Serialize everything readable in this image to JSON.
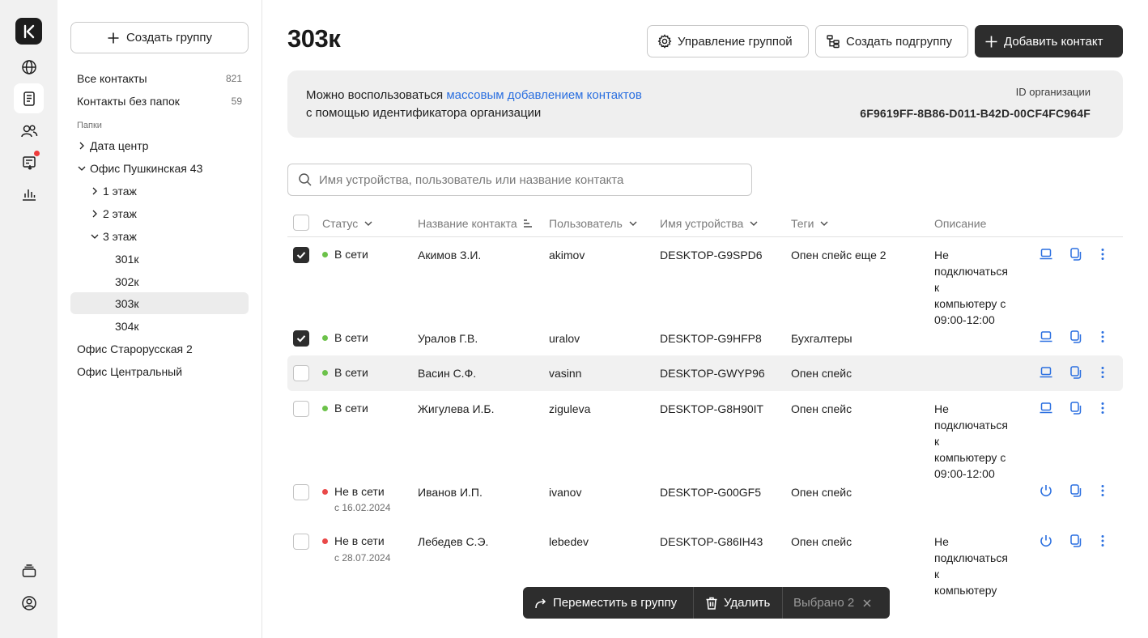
{
  "rail": {
    "logo_letter": "K",
    "items": [
      "globe-icon",
      "contacts-book-icon",
      "users-icon",
      "tasks-icon",
      "stats-icon"
    ],
    "bottom": [
      "stack-icon",
      "profile-icon"
    ]
  },
  "sidebar": {
    "create_group_label": "Создать группу",
    "all_contacts": {
      "label": "Все контакты",
      "count": "821"
    },
    "no_folder": {
      "label": "Контакты без папок",
      "count": "59"
    },
    "folders_caption": "Папки",
    "tree": [
      {
        "label": "Дата центр"
      },
      {
        "label": "Офис Пушкинская 43"
      },
      {
        "label": "1 этаж"
      },
      {
        "label": "2 этаж"
      },
      {
        "label": "3 этаж"
      },
      {
        "label": "301к"
      },
      {
        "label": "302к"
      },
      {
        "label": "303к"
      },
      {
        "label": "304к"
      },
      {
        "label": "Офис Старорусская 2"
      },
      {
        "label": "Офис Центральный"
      }
    ]
  },
  "header": {
    "title": "303к",
    "manage_label": "Управление группой",
    "subgroup_label": "Создать подгруппу",
    "add_contact_label": "Добавить контакт"
  },
  "info": {
    "text_before": "Можно воспользоваться ",
    "link": "массовым добавлением контактов",
    "text_line2": "с помощью идентификатора организации",
    "org_id_label": "ID организации",
    "org_id_value": "6F9619FF-8B86-D011-B42D-00CF4FC964F"
  },
  "search": {
    "placeholder": "Имя устройства, пользователь или название контакта"
  },
  "table": {
    "headers": {
      "status": "Статус",
      "name": "Название контакта",
      "user": "Пользователь",
      "device": "Имя устройства",
      "tags": "Теги",
      "description": "Описание"
    },
    "rows": [
      {
        "checked": true,
        "status": "В сети",
        "online": true,
        "since": "",
        "name": "Акимов З.И.",
        "user": "akimov",
        "device": "DESKTOP-G9SPD6",
        "tags": "Опен спейс еще 2",
        "desc": [
          "Не",
          "подключаться к",
          "компьютеру с",
          "09:00-12:00"
        ]
      },
      {
        "checked": true,
        "status": "В сети",
        "online": true,
        "since": "",
        "name": "Уралов Г.В.",
        "user": "uralov",
        "device": "DESKTOP-G9HFP8",
        "tags": "Бухгалтеры",
        "desc": []
      },
      {
        "checked": false,
        "status": "В сети",
        "online": true,
        "since": "",
        "name": "Васин С.Ф.",
        "user": "vasinn",
        "device": "DESKTOP-GWYP96",
        "tags": "Опен спейс",
        "desc": []
      },
      {
        "checked": false,
        "status": "В сети",
        "online": true,
        "since": "",
        "name": "Жигулева И.Б.",
        "user": "ziguleva",
        "device": "DESKTOP-G8H90IT",
        "tags": "Опен спейс",
        "desc": [
          "Не",
          "подключаться к",
          "компьютеру с",
          "09:00-12:00"
        ]
      },
      {
        "checked": false,
        "status": "Не в сети",
        "online": false,
        "since": "с 16.02.2024",
        "name": "Иванов И.П.",
        "user": "ivanov",
        "device": "DESKTOP-G00GF5",
        "tags": "Опен спейс",
        "desc": []
      },
      {
        "checked": false,
        "status": "Не в сети",
        "online": false,
        "since": "с 28.07.2024",
        "name": "Лебедев С.Э.",
        "user": "lebedev",
        "device": "DESKTOP-G86IH43",
        "tags": "Опен спейс",
        "desc": [
          "Не",
          "подключаться к",
          "компьютеру"
        ]
      }
    ]
  },
  "action_bar": {
    "move_label": "Переместить в группу",
    "delete_label": "Удалить",
    "selected_label": "Выбрано 2"
  },
  "colors": {
    "accent": "#2a6fe0",
    "dark": "#2d2d2d",
    "online": "#6cc24a",
    "offline": "#e94848"
  }
}
